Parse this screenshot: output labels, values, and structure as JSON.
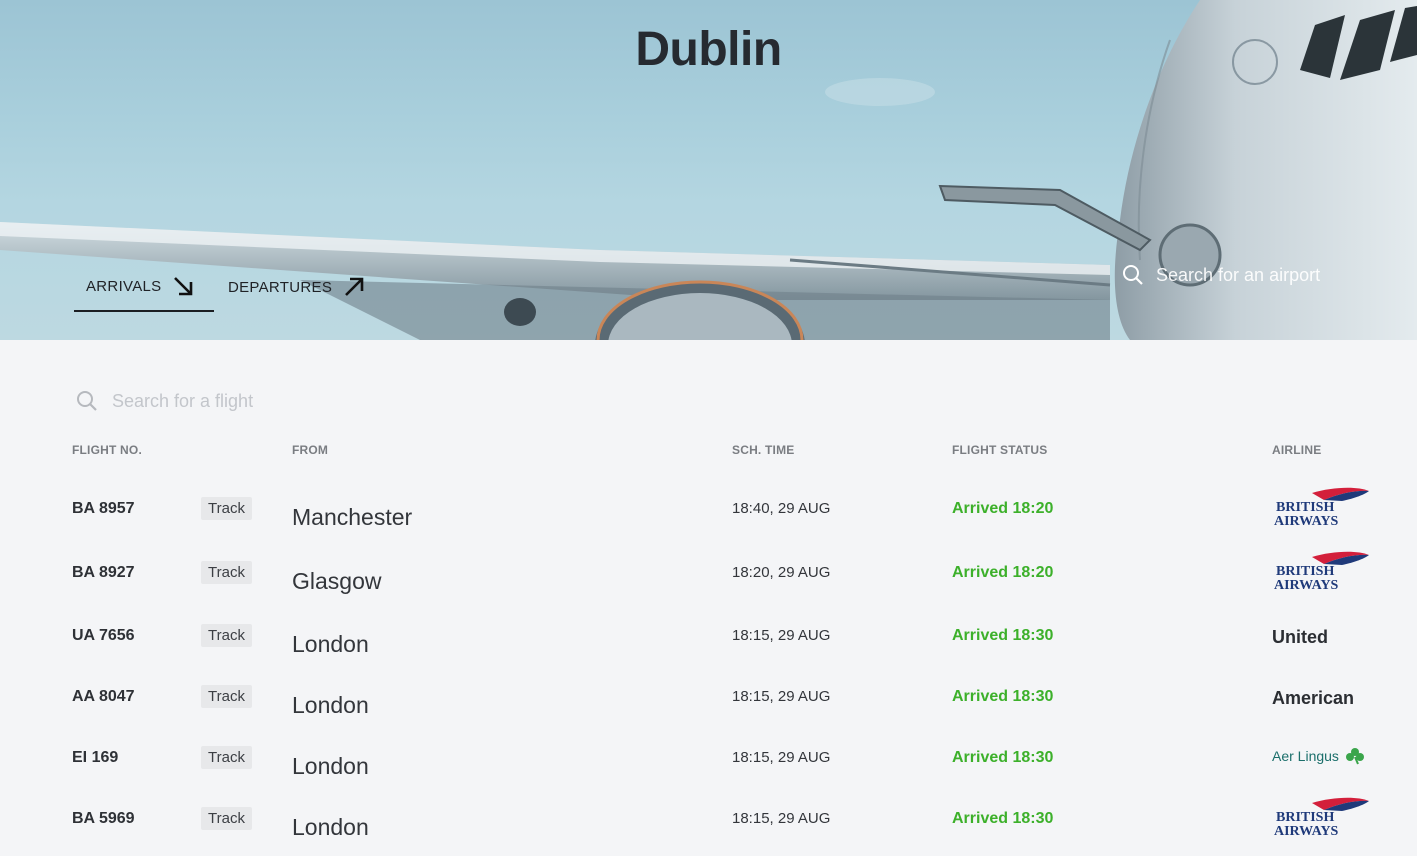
{
  "hero": {
    "title": "Dublin",
    "tabs": [
      {
        "label": "ARRIVALS",
        "active": true
      },
      {
        "label": "DEPARTURES",
        "active": false
      }
    ],
    "airport_search": {
      "placeholder": "Search for an airport"
    }
  },
  "flight_search": {
    "placeholder": "Search for a flight"
  },
  "columns": {
    "flight_no": "FLIGHT NO.",
    "from": "FROM",
    "sch_time": "SCH. TIME",
    "status": "FLIGHT STATUS",
    "airline": "AIRLINE"
  },
  "track_label": "Track",
  "flights": [
    {
      "flight_no": "BA 8957",
      "from": "Manchester",
      "sch_time": "18:40, 29 AUG",
      "status": "Arrived 18:20",
      "airline": "British Airways",
      "airline_kind": "ba-logo"
    },
    {
      "flight_no": "BA 8927",
      "from": "Glasgow",
      "sch_time": "18:20, 29 AUG",
      "status": "Arrived 18:20",
      "airline": "British Airways",
      "airline_kind": "ba-logo"
    },
    {
      "flight_no": "UA 7656",
      "from": "London",
      "sch_time": "18:15, 29 AUG",
      "status": "Arrived 18:30",
      "airline": "United",
      "airline_kind": "text"
    },
    {
      "flight_no": "AA 8047",
      "from": "London",
      "sch_time": "18:15, 29 AUG",
      "status": "Arrived 18:30",
      "airline": "American",
      "airline_kind": "text"
    },
    {
      "flight_no": "EI 169",
      "from": "London",
      "sch_time": "18:15, 29 AUG",
      "status": "Arrived 18:30",
      "airline": "Aer Lingus",
      "airline_kind": "aer-logo"
    },
    {
      "flight_no": "BA 5969",
      "from": "London",
      "sch_time": "18:15, 29 AUG",
      "status": "Arrived 18:30",
      "airline": "British Airways",
      "airline_kind": "ba-logo"
    }
  ],
  "colors": {
    "status_green": "#3cb02a",
    "ba_red": "#d31f3b",
    "ba_navy": "#1f3a7a",
    "aer_lingus_green": "#1b6f6b"
  },
  "icons": {
    "arrivals_arrow": "arrow-down-right-icon",
    "departures_arrow": "arrow-up-right-icon",
    "search": "search-icon",
    "shamrock": "shamrock-icon"
  }
}
